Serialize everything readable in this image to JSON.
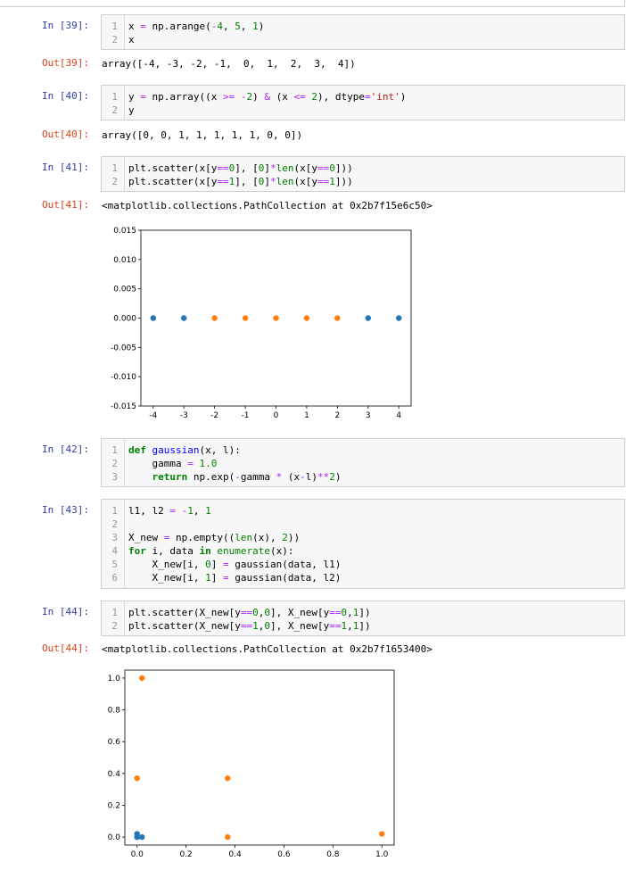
{
  "cells": [
    {
      "type": "in",
      "prompt": "In  [39]:",
      "lines": [
        "x = np.arange(-4, 5, 1)",
        "x"
      ]
    },
    {
      "type": "out",
      "prompt": "Out[39]:",
      "text": "array([-4, -3, -2, -1,  0,  1,  2,  3,  4])"
    },
    {
      "type": "in",
      "prompt": "In  [40]:",
      "lines": [
        "y = np.array((x >= -2) & (x <= 2), dtype='int')",
        "y"
      ]
    },
    {
      "type": "out",
      "prompt": "Out[40]:",
      "text": "array([0, 0, 1, 1, 1, 1, 1, 0, 0])"
    },
    {
      "type": "in",
      "prompt": "In  [41]:",
      "lines": [
        "plt.scatter(x[y==0], [0]*len(x[y==0]))",
        "plt.scatter(x[y==1], [0]*len(x[y==1]))"
      ]
    },
    {
      "type": "out",
      "prompt": "Out[41]:",
      "text": "<matplotlib.collections.PathCollection at 0x2b7f15e6c50>"
    },
    {
      "type": "in",
      "prompt": "In  [42]:",
      "lines": [
        "def gaussian(x, l):",
        "    gamma = 1.0",
        "    return np.exp(-gamma * (x-l)**2)"
      ]
    },
    {
      "type": "in",
      "prompt": "In  [43]:",
      "lines": [
        "l1, l2 = -1, 1",
        "",
        "X_new = np.empty((len(x), 2))",
        "for i, data in enumerate(x):",
        "    X_new[i, 0] = gaussian(data, l1)",
        "    X_new[i, 1] = gaussian(data, l2)"
      ]
    },
    {
      "type": "in",
      "prompt": "In  [44]:",
      "lines": [
        "plt.scatter(X_new[y==0,0], X_new[y==0,1])",
        "plt.scatter(X_new[y==1,0], X_new[y==1,1])"
      ]
    },
    {
      "type": "out",
      "prompt": "Out[44]:",
      "text": "<matplotlib.collections.PathCollection at 0x2b7f1653400>"
    }
  ],
  "chart_data": [
    {
      "type": "scatter",
      "xlim": [
        -4.4,
        4.4
      ],
      "ylim": [
        -0.015,
        0.015
      ],
      "x_ticks": [
        "-4",
        "-3",
        "-2",
        "-1",
        "0",
        "1",
        "2",
        "3",
        "4"
      ],
      "y_ticks": [
        "0.015",
        "0.010",
        "0.005",
        "0.000",
        "-0.005",
        "-0.010",
        "-0.015"
      ],
      "series": [
        {
          "color": "#1f77b4",
          "x": [
            -4,
            -3,
            3,
            4
          ],
          "y": [
            0,
            0,
            0,
            0
          ]
        },
        {
          "color": "#ff7f0e",
          "x": [
            -2,
            -1,
            0,
            1,
            2
          ],
          "y": [
            0,
            0,
            0,
            0,
            0
          ]
        }
      ]
    },
    {
      "type": "scatter",
      "xlim": [
        -0.05,
        1.05
      ],
      "ylim": [
        -0.05,
        1.05
      ],
      "x_ticks": [
        "0.0",
        "0.2",
        "0.4",
        "0.6",
        "0.8",
        "1.0"
      ],
      "y_ticks": [
        "1.0",
        "0.8",
        "0.6",
        "0.4",
        "0.2",
        "0.0"
      ],
      "series": [
        {
          "color": "#1f77b4",
          "x": [
            0.0,
            0.0,
            0.0,
            0.02
          ],
          "y": [
            0.0,
            0.02,
            0.0,
            0.0
          ]
        },
        {
          "color": "#ff7f0e",
          "x": [
            0.02,
            0.0,
            0.37,
            0.37,
            1.0
          ],
          "y": [
            1.0,
            0.37,
            0.37,
            0.0,
            0.02
          ]
        }
      ]
    }
  ]
}
